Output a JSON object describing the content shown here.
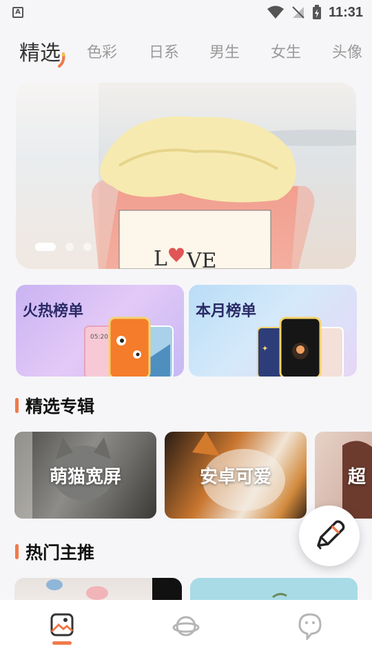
{
  "status_bar": {
    "time": "11:31",
    "app_indicator": "A"
  },
  "tabs": [
    {
      "label": "精选",
      "active": true
    },
    {
      "label": "色彩"
    },
    {
      "label": "日系"
    },
    {
      "label": "男生"
    },
    {
      "label": "女生"
    },
    {
      "label": "头像"
    }
  ],
  "banner": {
    "text": "LOVE",
    "slides": 3,
    "active_slide": 1
  },
  "rank_cards": [
    {
      "title": "火热榜单",
      "phone_text": "05:20"
    },
    {
      "title": "本月榜单"
    }
  ],
  "sections": {
    "featured": "精选专辑",
    "hot": "热门主推"
  },
  "albums": [
    {
      "name": "萌猫宽屏"
    },
    {
      "name": "安卓可爱"
    },
    {
      "name": "超"
    }
  ],
  "nav": [
    {
      "icon": "gallery-icon",
      "active": true
    },
    {
      "icon": "planet-icon"
    },
    {
      "icon": "chat-icon"
    }
  ],
  "colors": {
    "accent": "#f07a4a",
    "rank_title": "#2a2a66"
  }
}
